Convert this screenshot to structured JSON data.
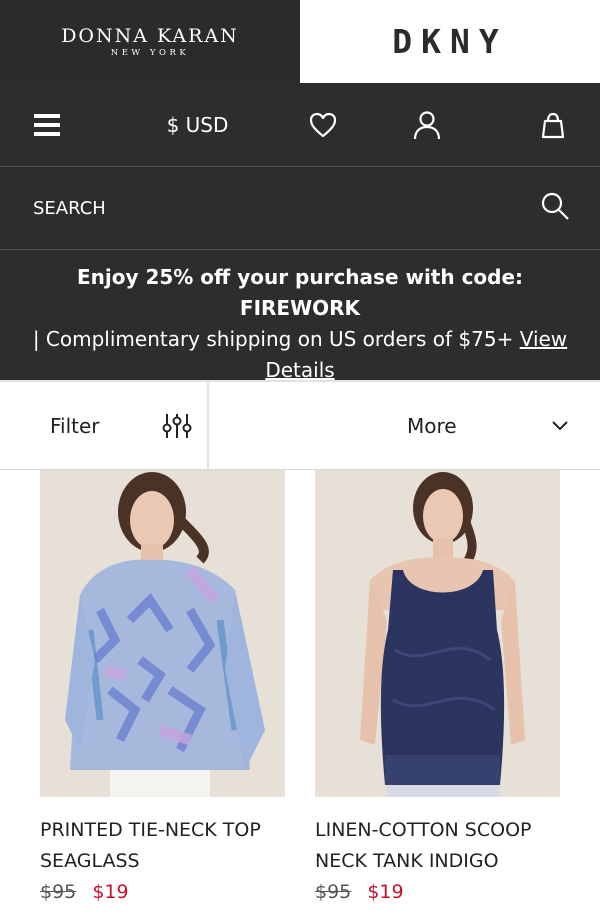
{
  "brand": {
    "donna_karan_main": "DONNA KARAN",
    "donna_karan_sub": "NEW YORK",
    "dkny": "DKNY"
  },
  "nav": {
    "menu_icon": "hamburger-icon",
    "currency": "$ USD",
    "wishlist_icon": "heart-icon",
    "account_icon": "user-icon",
    "bag_icon": "shopping-bag-icon"
  },
  "search": {
    "placeholder": "SEARCH",
    "icon": "search-icon"
  },
  "promo": {
    "headline": "Enjoy 25% off your purchase with code: FIREWORK",
    "shipping": "| Complimentary shipping on US orders of $75+",
    "link": "View Details"
  },
  "controls": {
    "filter_label": "Filter",
    "filter_icon": "sliders-icon",
    "more_label": "More",
    "more_icon": "chevron-down-icon"
  },
  "products": [
    {
      "name": "PRINTED TIE-NECK TOP SEAGLASS",
      "price_original": "$95",
      "price_sale": "$19"
    },
    {
      "name": "LINEN-COTTON SCOOP NECK TANK INDIGO",
      "price_original": "$95",
      "price_sale": "$19"
    }
  ],
  "colors": {
    "header_bg": "#2d2d2d",
    "sale_price": "#c8102e",
    "page_bg": "#ffffff"
  }
}
